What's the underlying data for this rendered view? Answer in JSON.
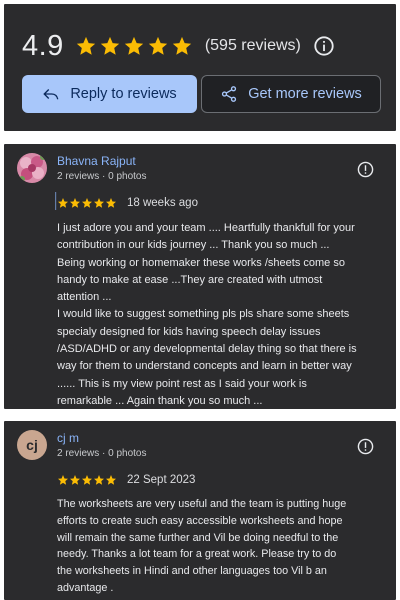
{
  "summary": {
    "rating": "4.9",
    "stars": 5,
    "review_count": "(595 reviews)",
    "info_icon": "info-icon",
    "reply_button": "Reply to reviews",
    "more_button": "Get more reviews",
    "colors": {
      "star": "#fbbc04",
      "primary_button_bg": "#a8c7fa",
      "link": "#a8c7fa"
    }
  },
  "reviews": [
    {
      "name": "Bhavna Rajput",
      "meta": "2 reviews · 0 photos",
      "stars": 5,
      "date": "18 weeks ago",
      "avatar_icon": "flower-avatar",
      "text": "I just adore you and your team .... Heartfully thankfull for your\ncontribution in our kids journey ... Thank you so much ...\nBeing working or homemaker these works /sheets come so\nhandy to make at ease ...They are created with utmost\nattention ...\nI would like to suggest something pls pls share some sheets\nspecialy designed for kids having speech delay issues\n/ASD/ADHD or any developmental delay thing so that there is\nway for them to understand concepts and learn in better way\n...... This is my view point rest as I said your work is\nremarkable ... Again thank you so much ..."
    },
    {
      "name": "cj m",
      "meta": "2 reviews · 0 photos",
      "stars": 5,
      "date": "22 Sept 2023",
      "avatar_letters": "cj",
      "text": "The worksheets are very useful and the team is putting huge\nefforts to create such easy accessible worksheets and hope\nwill remain the same further and Vil be doing needful to the\nneedy. Thanks a lot team for a great work. Please try to do\nthe worksheets in Hindi and other languages too Vil b an\nadvantage ."
    }
  ]
}
